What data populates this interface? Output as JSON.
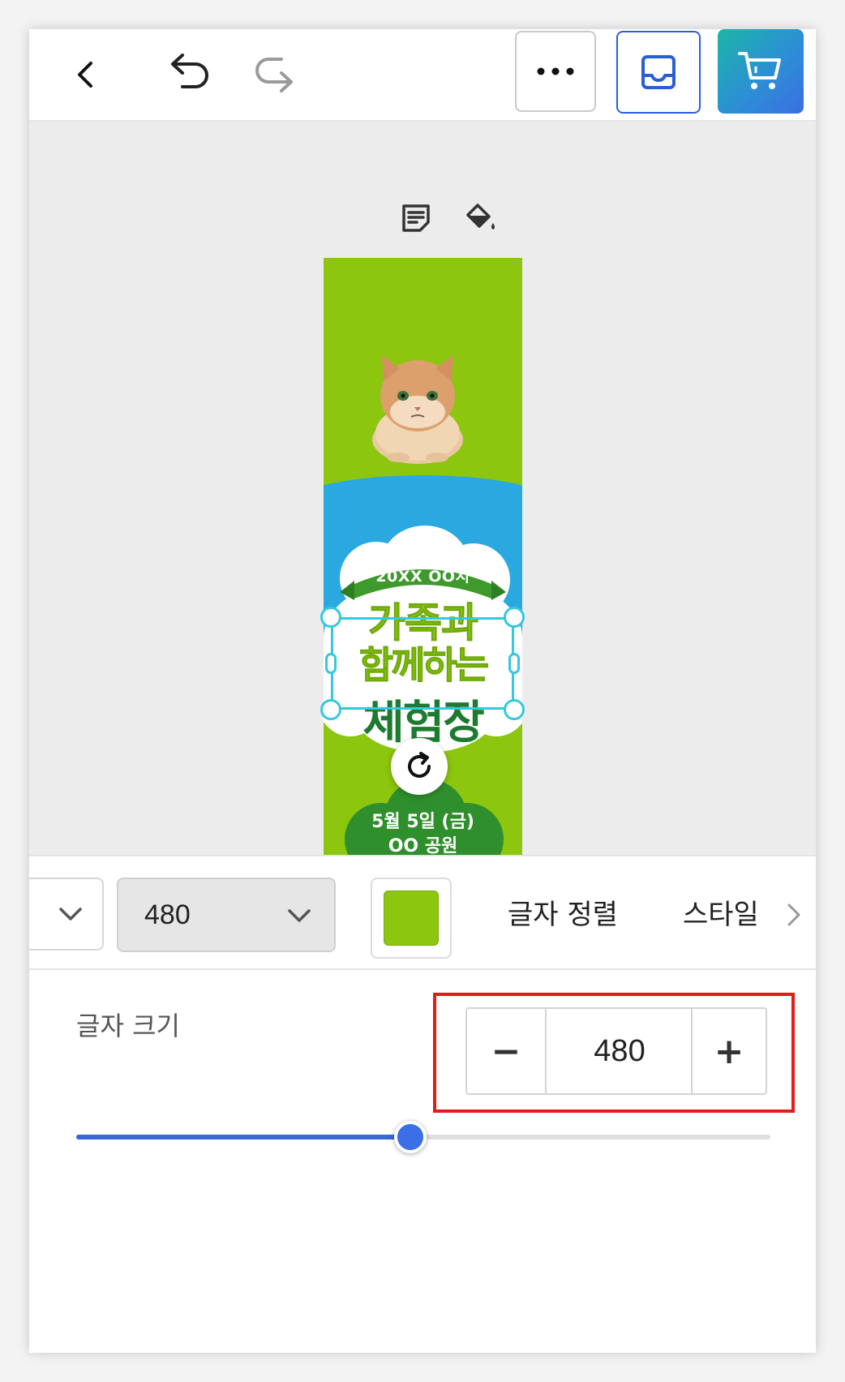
{
  "toolbar": {
    "icons": [
      "chevron-left-icon",
      "undo-icon",
      "redo-icon",
      "more-icon",
      "inbox-icon",
      "cart-icon"
    ]
  },
  "floating_tools": {
    "icons": [
      "note-icon",
      "paint-bucket-icon"
    ]
  },
  "banner": {
    "ribbon": "20XX OO시",
    "title_line1": "가족과",
    "title_line2": "함께하는",
    "title_line3": "체험장",
    "date": "5월 5일 (금)",
    "place": "OO 공원",
    "colors": {
      "background": "#8cc60f",
      "band": "#2aa8e0",
      "title_green": "#8cc60f",
      "title_dark": "#1d7a2f"
    }
  },
  "text_toolbar": {
    "font_size_value": "480",
    "color_hex": "#8cc60f",
    "align_label": "글자 정렬",
    "style_label": "스타일"
  },
  "size_panel": {
    "label": "글자 크기",
    "value": "480",
    "minus_label": "−",
    "plus_label": "+",
    "slider_fraction": 0.481
  },
  "accent_colors": {
    "selection": "#36c8de",
    "slider": "#3a66d8",
    "highlight": "#e31b1b"
  }
}
